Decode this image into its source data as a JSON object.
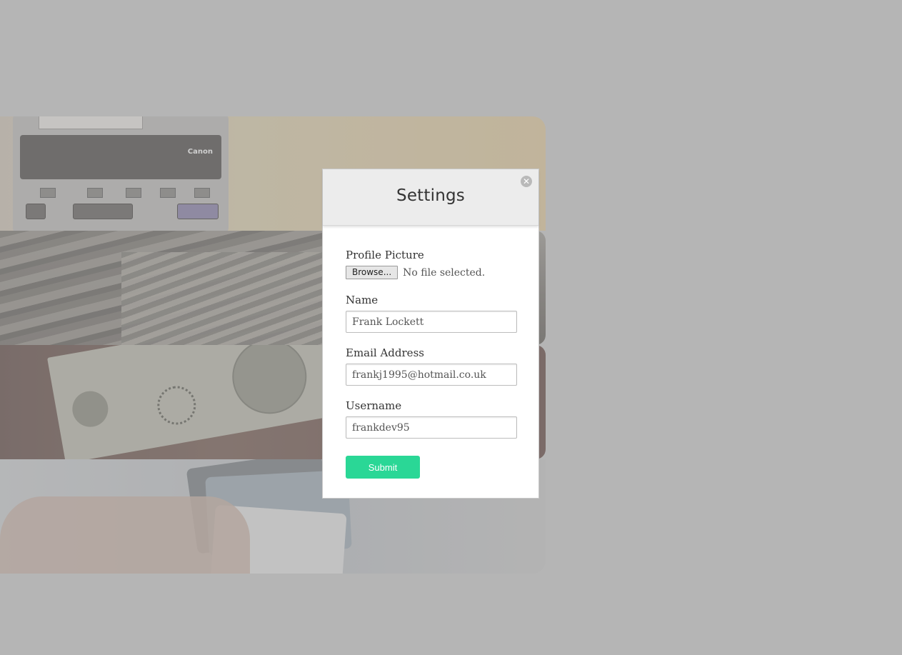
{
  "modal": {
    "title": "Settings",
    "close_icon": "close-icon"
  },
  "form": {
    "profile_picture_label": "Profile Picture",
    "browse_label": "Browse...",
    "file_status": "No file selected.",
    "name_label": "Name",
    "name_value": "Frank Lockett",
    "email_label": "Email Address",
    "email_value": "frankj1995@hotmail.co.uk",
    "username_label": "Username",
    "username_value": "frankdev95",
    "submit_label": "Submit"
  },
  "colors": {
    "page_background": "#b5b5b5",
    "modal_header": "#ececec",
    "submit_button": "#2ad796"
  }
}
